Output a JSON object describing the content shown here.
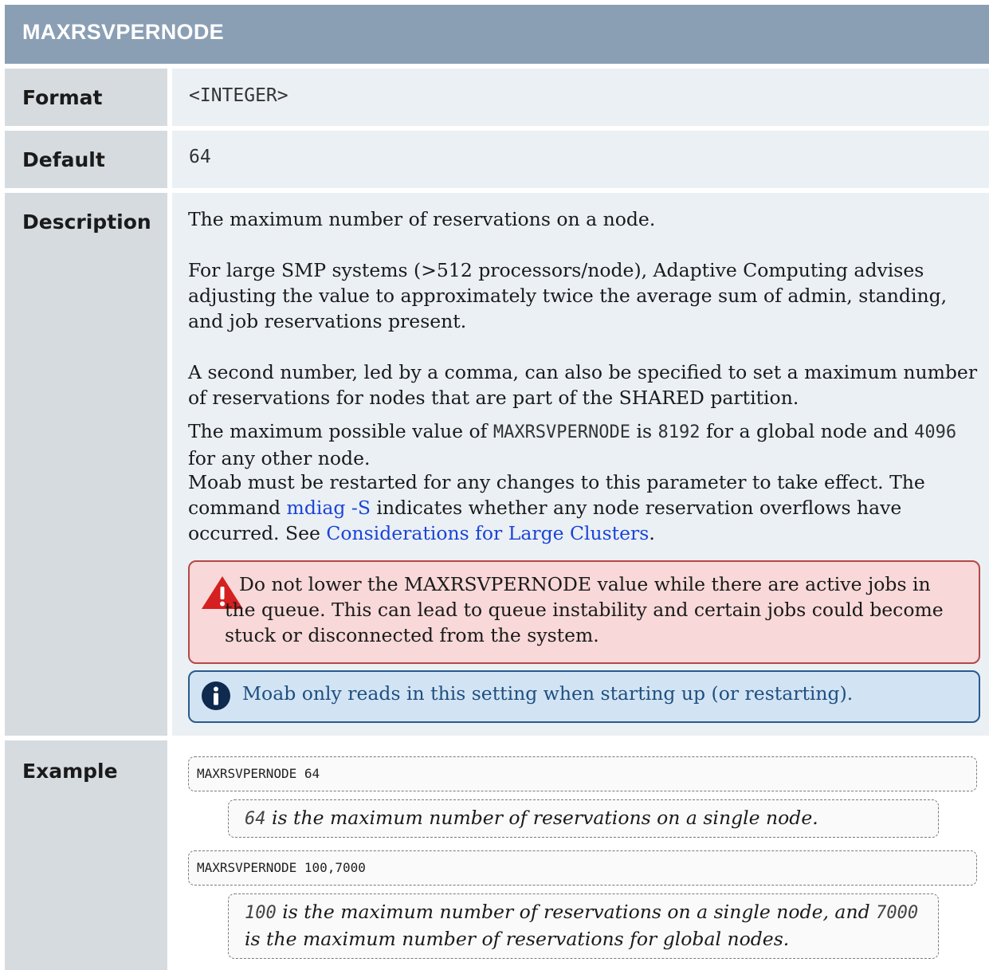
{
  "title": "MAXRSVPERNODE",
  "format": {
    "label": "Format",
    "value": "<INTEGER>"
  },
  "default": {
    "label": "Default",
    "value": "64"
  },
  "description": {
    "label": "Description",
    "p1": "The maximum number of reservations on a node.",
    "p2": "For large SMP systems (>512 processors/node), Adaptive Computing advises adjusting the value to approximately twice the average sum of admin, standing, and job reservations present.",
    "p3": "A second number, led by a comma, can also be specified to set a maximum number of reservations for nodes that are part of the SHARED partition.",
    "p4_a": "The maximum possible value of ",
    "p4_code": "MAXRSVPERNODE",
    "p4_b": " is ",
    "p4_code2": "8192",
    "p4_c": " for a global node and ",
    "p4_code3": "4096",
    "p4_d": " for any other node.",
    "p5_a": "Moab must be restarted for any changes to this parameter to take effect. The command ",
    "p5_link1": "mdiag -S",
    "p5_b": " indicates whether any node reservation overflows have occurred. See ",
    "p5_link2": "Considerations for Large Clusters",
    "p5_c": ".",
    "warning": "Do not lower the MAXRSVPERNODE value while there are active jobs in the queue. This can lead to queue instability and certain jobs could become stuck or disconnected from the system.",
    "info": "Moab only reads in this setting when starting up (or restarting)."
  },
  "example": {
    "label": "Example",
    "code1": "MAXRSVPERNODE 64",
    "note1_code": "64",
    "note1_text": " is the maximum number of reservations on a single node.",
    "code2": "MAXRSVPERNODE 100,7000",
    "note2_code1": "100",
    "note2_text1": " is the maximum number of reservations on a single node, and ",
    "note2_code2": "7000",
    "note2_text2": " is the maximum number of reservations for global nodes."
  },
  "colors": {
    "header_bg": "#8a9fb4",
    "label_bg": "#d6dbe0",
    "value_bg": "#ebf0f5",
    "warning_bg": "#f8d8d8",
    "warning_border": "#b54848",
    "info_bg": "#d2e4f4",
    "info_border": "#2a5a8c",
    "link": "#1a44d6"
  },
  "icons": {
    "warning": "warning-triangle-icon",
    "info": "info-circle-icon"
  }
}
